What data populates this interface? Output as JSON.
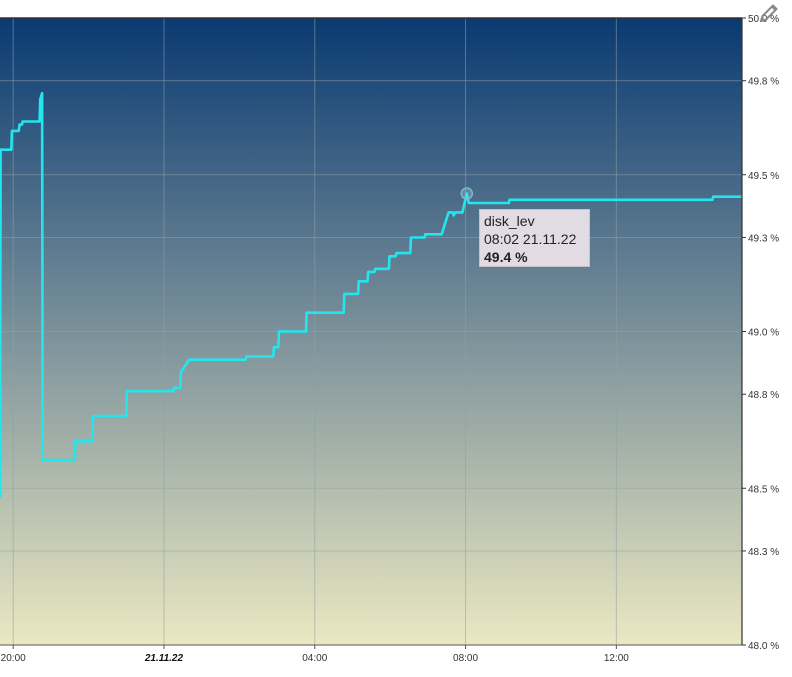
{
  "chart_data": {
    "type": "line",
    "series": [
      {
        "name": "disk_lev",
        "color": "#22e6ee",
        "points": [
          [
            "20.11.22 19:39",
            48.47
          ],
          [
            "20.11.22 19:40",
            49.58
          ],
          [
            "20.11.22 19:57",
            49.58
          ],
          [
            "20.11.22 19:58",
            49.64
          ],
          [
            "20.11.22 20:09",
            49.64
          ],
          [
            "20.11.22 20:10",
            49.66
          ],
          [
            "20.11.22 20:14",
            49.66
          ],
          [
            "20.11.22 20:15",
            49.67
          ],
          [
            "20.11.22 20:42",
            49.67
          ],
          [
            "20.11.22 20:43",
            49.74
          ],
          [
            "20.11.22 20:46",
            49.76
          ],
          [
            "20.11.22 20:47",
            48.59
          ],
          [
            "20.11.22 21:38",
            48.59
          ],
          [
            "20.11.22 21:39",
            48.65
          ],
          [
            "20.11.22 22:06",
            48.65
          ],
          [
            "20.11.22 22:07",
            48.73
          ],
          [
            "20.11.22 23:00",
            48.73
          ],
          [
            "20.11.22 23:01",
            48.81
          ],
          [
            "21.11.22 00:15",
            48.81
          ],
          [
            "21.11.22 00:16",
            48.82
          ],
          [
            "21.11.22 00:26",
            48.82
          ],
          [
            "21.11.22 00:27",
            48.87
          ],
          [
            "21.11.22 00:40",
            48.91
          ],
          [
            "21.11.22 02:10",
            48.91
          ],
          [
            "21.11.22 02:11",
            48.92
          ],
          [
            "21.11.22 02:54",
            48.92
          ],
          [
            "21.11.22 02:55",
            48.95
          ],
          [
            "21.11.22 03:02",
            48.95
          ],
          [
            "21.11.22 03:03",
            49.0
          ],
          [
            "21.11.22 03:46",
            49.0
          ],
          [
            "21.11.22 03:47",
            49.06
          ],
          [
            "21.11.22 04:46",
            49.06
          ],
          [
            "21.11.22 04:47",
            49.12
          ],
          [
            "21.11.22 05:09",
            49.12
          ],
          [
            "21.11.22 05:10",
            49.16
          ],
          [
            "21.11.22 05:24",
            49.16
          ],
          [
            "21.11.22 05:25",
            49.19
          ],
          [
            "21.11.22 05:35",
            49.19
          ],
          [
            "21.11.22 05:36",
            49.2
          ],
          [
            "21.11.22 05:58",
            49.2
          ],
          [
            "21.11.22 05:59",
            49.24
          ],
          [
            "21.11.22 06:09",
            49.24
          ],
          [
            "21.11.22 06:10",
            49.25
          ],
          [
            "21.11.22 06:32",
            49.25
          ],
          [
            "21.11.22 06:33",
            49.3
          ],
          [
            "21.11.22 06:55",
            49.3
          ],
          [
            "21.11.22 06:56",
            49.31
          ],
          [
            "21.11.22 07:22",
            49.31
          ],
          [
            "21.11.22 07:33",
            49.38
          ],
          [
            "21.11.22 07:40",
            49.38
          ],
          [
            "21.11.22 07:41",
            49.37
          ],
          [
            "21.11.22 07:44",
            49.38
          ],
          [
            "21.11.22 07:55",
            49.38
          ],
          [
            "21.11.22 08:02",
            49.44
          ],
          [
            "21.11.22 08:05",
            49.41
          ],
          [
            "21.11.22 09:09",
            49.41
          ],
          [
            "21.11.22 09:10",
            49.42
          ],
          [
            "21.11.22 14:33",
            49.42
          ],
          [
            "21.11.22 14:34",
            49.43
          ],
          [
            "21.11.22 15:20",
            49.43
          ]
        ]
      }
    ],
    "x_ticks": [
      {
        "time": "20.11.22 20:00",
        "label": "20:00",
        "bold": false
      },
      {
        "time": "21.11.22 00:00",
        "label": "21.11.22",
        "bold": true
      },
      {
        "time": "21.11.22 04:00",
        "label": "04:00",
        "bold": false
      },
      {
        "time": "21.11.22 08:00",
        "label": "08:00",
        "bold": false
      },
      {
        "time": "21.11.22 12:00",
        "label": "12:00",
        "bold": false
      }
    ],
    "y_ticks": [
      {
        "value": 50.0,
        "label": "50.0 %"
      },
      {
        "value": 49.8,
        "label": "49.8 %"
      },
      {
        "value": 49.5,
        "label": "49.5 %"
      },
      {
        "value": 49.3,
        "label": "49.3 %"
      },
      {
        "value": 49.0,
        "label": "49.0 %"
      },
      {
        "value": 48.8,
        "label": "48.8 %"
      },
      {
        "value": 48.5,
        "label": "48.5 %"
      },
      {
        "value": 48.3,
        "label": "48.3 %"
      },
      {
        "value": 48.0,
        "label": "48.0 %"
      }
    ],
    "xlim": [
      "20.11.22 19:39",
      "21.11.22 15:20"
    ],
    "ylim": [
      48.0,
      50.0
    ],
    "grid": true,
    "y_axis_side": "right",
    "background_gradient": {
      "top": "#0a3a72",
      "bottom": "#ebe8c2"
    },
    "grid_color": "#8fa0a6"
  },
  "tooltip": {
    "series": "disk_lev",
    "time": "08:02 21.11.22",
    "value": "49.4 %",
    "point": [
      "21.11.22 08:02",
      49.44
    ]
  },
  "toolbar": {
    "edit_icon": "pencil-icon",
    "icon_color": "#8a8a8a"
  }
}
